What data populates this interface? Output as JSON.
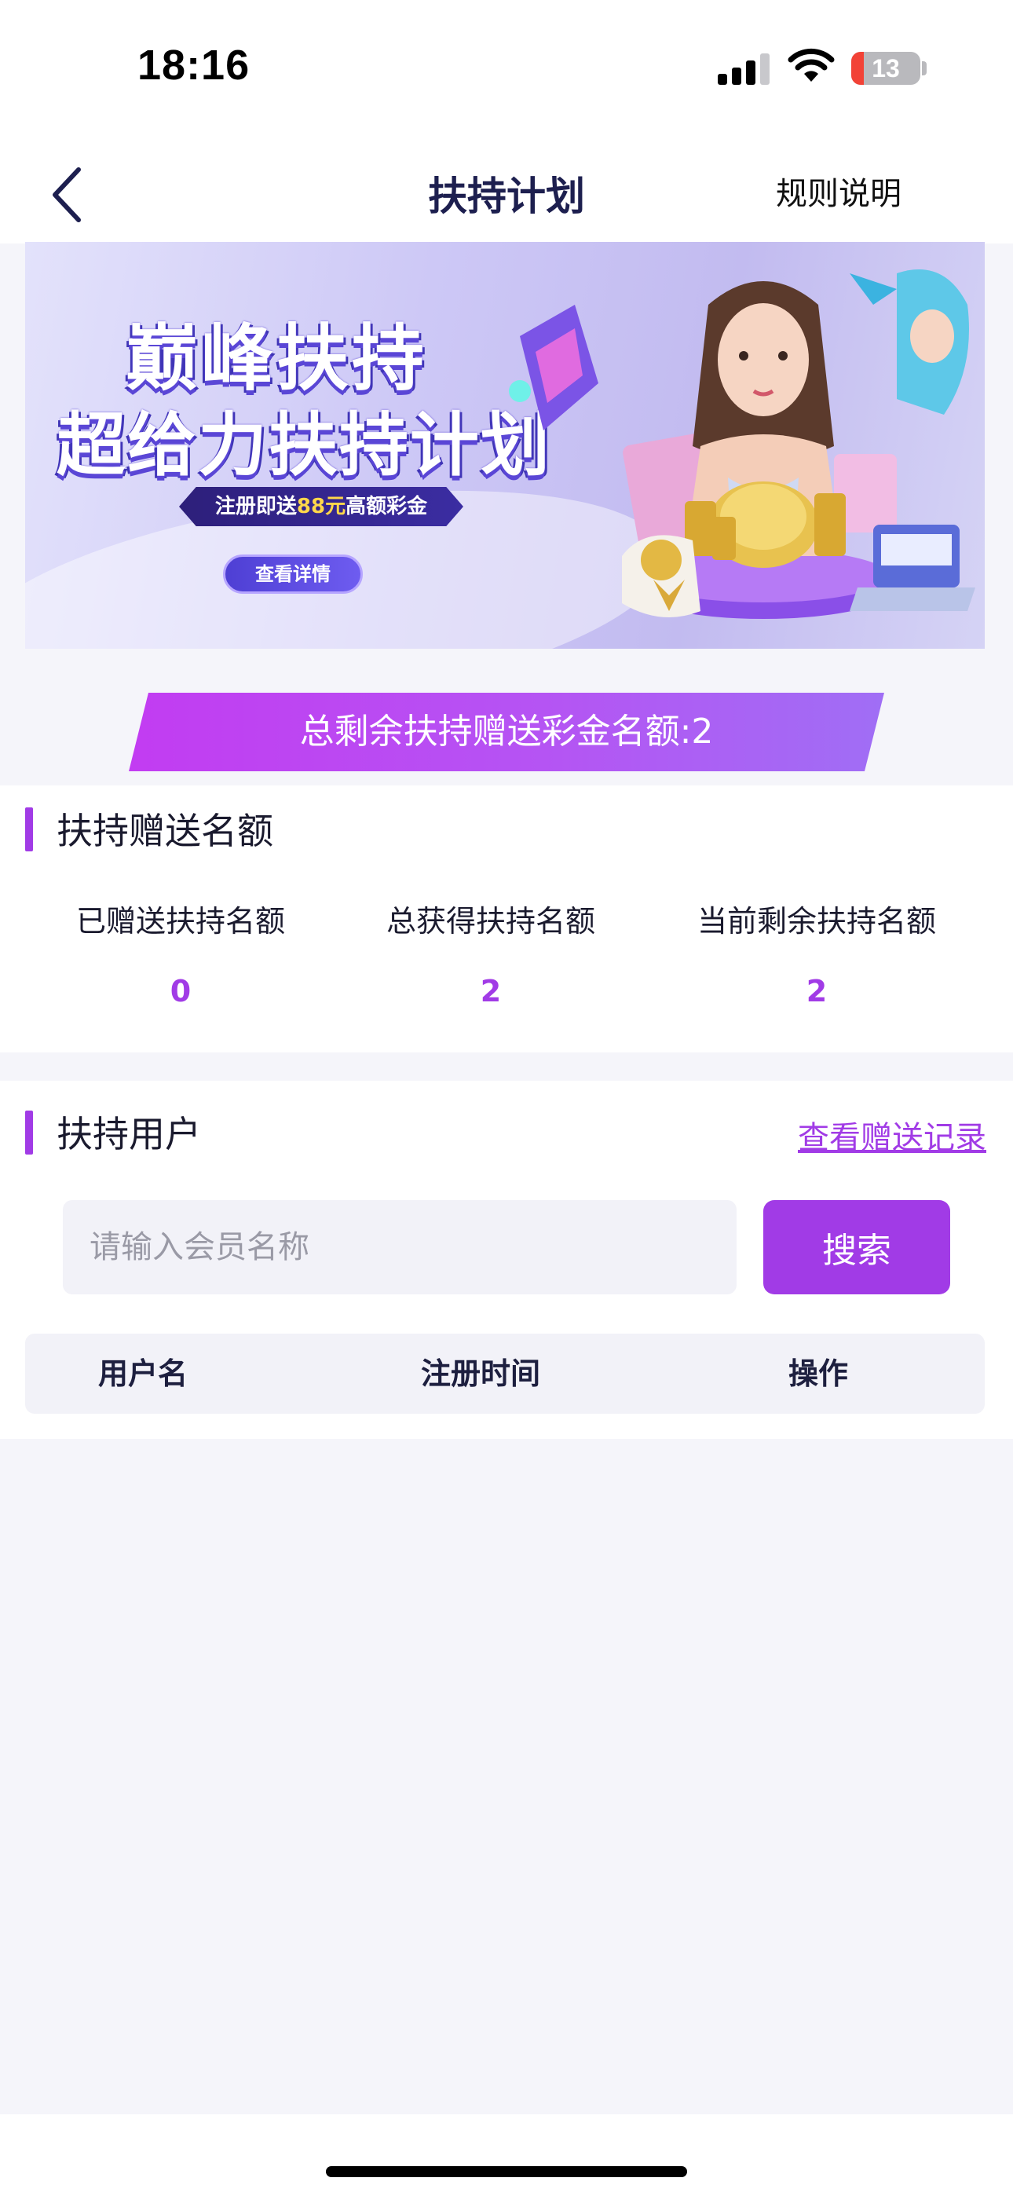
{
  "status_bar": {
    "time": "18:16",
    "battery_level": "13"
  },
  "nav": {
    "title": "扶持计划",
    "rules_label": "规则说明"
  },
  "banner": {
    "title_line1": "巅峰扶持",
    "title_line2": "超给力扶持计划",
    "promo_prefix": "注册即送",
    "promo_amount": "88元",
    "promo_suffix": "高额彩金",
    "detail_button": "查看详情"
  },
  "quota_banner": {
    "text": "总剩余扶持赠送彩金名额:2"
  },
  "support_quota": {
    "title": "扶持赠送名额",
    "stats": [
      {
        "label": "已赠送扶持名额",
        "value": "0"
      },
      {
        "label": "总获得扶持名额",
        "value": "2"
      },
      {
        "label": "当前剩余扶持名额",
        "value": "2"
      }
    ]
  },
  "support_users": {
    "title": "扶持用户",
    "record_link": "查看赠送记录",
    "search_placeholder": "请输入会员名称",
    "search_button": "搜索",
    "columns": [
      "用户名",
      "注册时间",
      "操作"
    ]
  },
  "colors": {
    "accent": "#a13be6",
    "nav_title": "#1d1f4f",
    "page_bg": "#f5f5fa"
  }
}
